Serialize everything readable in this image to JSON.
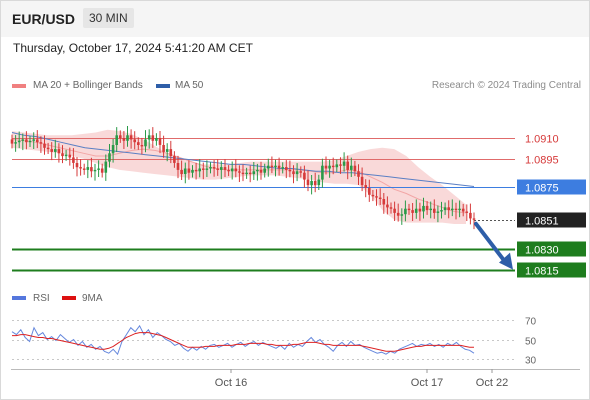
{
  "header": {
    "symbol": "EUR/USD",
    "timeframe": "30 MIN",
    "timestamp": "Thursday, October 17, 2024 5:41:20 AM CET"
  },
  "legend": {
    "ma20_label": "MA 20 + Bollinger Bands",
    "ma50_label": "MA 50",
    "credit": "Research © 2024 Trading Central",
    "rsi_label": "RSI",
    "ma9_label": "9MA"
  },
  "colors": {
    "up": "#2a9a48",
    "down": "#d63a3a",
    "bollinger_fill": "#f7cccc",
    "ma50": "#5a7fc4",
    "resistance": "#e06b6b",
    "pivot": "#3d7de0",
    "support": "#1e7d1e",
    "forecast_arrow": "#2e5ea8",
    "rsi": "#6688dd",
    "rsi_ma": "#dd2222"
  },
  "chart_data": [
    {
      "type": "candlestick",
      "title": "EUR/USD 30 MIN",
      "ylim": [
        1.0809,
        1.0936
      ],
      "x_ticks": [
        "Oct 16",
        "Oct 17",
        "Oct 22"
      ],
      "levels": [
        {
          "value": 1.091,
          "label": "1.0910",
          "kind": "resistance"
        },
        {
          "value": 1.0895,
          "label": "1.0895",
          "kind": "resistance"
        },
        {
          "value": 1.0875,
          "label": "1.0875",
          "kind": "pivot"
        },
        {
          "value": 1.0851,
          "label": "1.0851",
          "kind": "last"
        },
        {
          "value": 1.083,
          "label": "1.0830",
          "kind": "support"
        },
        {
          "value": 1.0815,
          "label": "1.0815",
          "kind": "support"
        }
      ],
      "close_path": [
        1.0906,
        1.0907,
        1.0908,
        1.0909,
        1.0907,
        1.0908,
        1.0909,
        1.0907,
        1.0906,
        1.0903,
        1.0902,
        1.09,
        1.0902,
        1.0899,
        1.0897,
        1.0898,
        1.0896,
        1.0892,
        1.0889,
        1.0888,
        1.0887,
        1.0889,
        1.0886,
        1.0887,
        1.0888,
        1.0885,
        1.0893,
        1.0899,
        1.0905,
        1.0912,
        1.091,
        1.0908,
        1.0912,
        1.0909,
        1.0907,
        1.0905,
        1.0904,
        1.0909,
        1.0912,
        1.0908,
        1.091,
        1.0905,
        1.09,
        1.0902,
        1.0897,
        1.0892,
        1.0887,
        1.0884,
        1.0888,
        1.0885,
        1.0887,
        1.0886,
        1.0888,
        1.0887,
        1.0888,
        1.0889,
        1.0888,
        1.0887,
        1.0889,
        1.0887,
        1.0886,
        1.0888,
        1.0886,
        1.0885,
        1.0884,
        1.0885,
        1.0884,
        1.0886,
        1.0887,
        1.0885,
        1.0888,
        1.089,
        1.0889,
        1.089,
        1.0888,
        1.0889,
        1.0887,
        1.0886,
        1.0884,
        1.0886,
        1.0885,
        1.088,
        1.0876,
        1.0879,
        1.0876,
        1.088,
        1.089,
        1.0888,
        1.089,
        1.0889,
        1.0891,
        1.089,
        1.0893,
        1.0887,
        1.089,
        1.0886,
        1.0882,
        1.0876,
        1.0874,
        1.0869,
        1.0868,
        1.0867,
        1.0866,
        1.0862,
        1.086,
        1.0859,
        1.0856,
        1.0854,
        1.0855,
        1.0859,
        1.0858,
        1.0856,
        1.0859,
        1.0857,
        1.0861,
        1.0858,
        1.0859,
        1.0856,
        1.0857,
        1.0858,
        1.086,
        1.0858,
        1.0859,
        1.0858,
        1.0859,
        1.0857,
        1.0856,
        1.0852,
        1.0851
      ],
      "ma20_path": [
        1.0909,
        1.0908,
        1.0907,
        1.0905,
        1.0903,
        1.0901,
        1.0899,
        1.0897,
        1.0897,
        1.0899,
        1.0901,
        1.0902,
        1.0901,
        1.0899,
        1.0896,
        1.0893,
        1.089,
        1.0888,
        1.0887,
        1.0887,
        1.0887,
        1.0887,
        1.0887,
        1.0887,
        1.0887,
        1.0886,
        1.0885,
        1.0885,
        1.0887,
        1.0886,
        1.0882,
        1.0878,
        1.0873,
        1.087,
        1.0866,
        1.0863,
        1.086,
        1.0857,
        1.0856
      ],
      "bb_upper_path": [
        1.0915,
        1.0914,
        1.0913,
        1.0912,
        1.0912,
        1.0912,
        1.0913,
        1.0914,
        1.0916,
        1.0915,
        1.0913,
        1.0909,
        1.0904,
        1.0899,
        1.0895,
        1.0893,
        1.0891,
        1.0891,
        1.0891,
        1.0892,
        1.0893,
        1.0893,
        1.0893,
        1.0893,
        1.0893,
        1.0893,
        1.0893,
        1.0894,
        1.0897,
        1.09,
        1.0902,
        1.0903,
        1.0902,
        1.0897,
        1.0889,
        1.0882,
        1.0876,
        1.0869,
        1.0862
      ],
      "bb_lower_path": [
        1.0903,
        1.0902,
        1.0901,
        1.09,
        1.0899,
        1.0897,
        1.0895,
        1.0892,
        1.0889,
        1.0887,
        1.0886,
        1.0885,
        1.0884,
        1.0883,
        1.0882,
        1.0881,
        1.088,
        1.088,
        1.0881,
        1.0882,
        1.0883,
        1.0883,
        1.0883,
        1.0882,
        1.0881,
        1.088,
        1.0878,
        1.0877,
        1.0877,
        1.0876,
        1.0869,
        1.0858,
        1.0851,
        1.0849,
        1.0849,
        1.0849,
        1.0849,
        1.0848,
        1.0848
      ],
      "ma50_path": [
        1.0914,
        1.0912,
        1.0911,
        1.0909,
        1.0907,
        1.0905,
        1.0903,
        1.0902,
        1.0901,
        1.09,
        1.0899,
        1.0898,
        1.0897,
        1.0896,
        1.0895,
        1.0894,
        1.0893,
        1.0892,
        1.0891,
        1.0891,
        1.089,
        1.0889,
        1.0888,
        1.0888,
        1.0887,
        1.0886,
        1.0886,
        1.0885,
        1.0885,
        1.0884,
        1.0883,
        1.0882,
        1.0881,
        1.088,
        1.0879,
        1.0878,
        1.0877,
        1.0876,
        1.0875
      ],
      "forecast": {
        "from": 1.0851,
        "to": 1.0815
      }
    },
    {
      "type": "line",
      "title": "RSI",
      "ylim": [
        25,
        75
      ],
      "y_ticks": [
        70,
        50,
        30
      ],
      "series": [
        {
          "name": "RSI",
          "values": [
            58,
            55,
            60,
            52,
            48,
            62,
            54,
            57,
            50,
            53,
            49,
            55,
            51,
            47,
            50,
            44,
            48,
            42,
            45,
            40,
            43,
            38,
            36,
            40,
            35,
            48,
            55,
            62,
            58,
            64,
            55,
            60,
            52,
            57,
            54,
            50,
            48,
            44,
            46,
            41,
            38,
            42,
            39,
            43,
            40,
            44,
            45,
            42,
            44,
            46,
            42,
            45,
            47,
            43,
            46,
            48,
            44,
            47,
            45,
            43,
            41,
            44,
            40,
            46,
            42,
            45,
            43,
            48,
            52,
            47,
            50,
            45,
            42,
            38,
            44,
            47,
            43,
            48,
            44,
            45,
            42,
            40,
            38,
            36,
            37,
            35,
            38,
            36,
            40,
            42,
            44,
            46,
            43,
            45,
            44,
            46,
            43,
            45,
            42,
            46,
            44,
            47,
            43,
            40,
            39,
            36
          ]
        },
        {
          "name": "9MA",
          "values": [
            54,
            54,
            55,
            55,
            54,
            53,
            52,
            52,
            51,
            51,
            50,
            49,
            48,
            47,
            46,
            45,
            44,
            43,
            42,
            41,
            40,
            40,
            41,
            43,
            46,
            49,
            52,
            54,
            56,
            57,
            57,
            57,
            56,
            55,
            54,
            52,
            50,
            48,
            46,
            44,
            42,
            42,
            42,
            42,
            43,
            43,
            43,
            44,
            44,
            44,
            44,
            45,
            45,
            45,
            46,
            46,
            46,
            46,
            45,
            45,
            44,
            44,
            44,
            44,
            45,
            45,
            46,
            47,
            47,
            47,
            46,
            45,
            45,
            44,
            44,
            44,
            44,
            44,
            44,
            44,
            43,
            42,
            41,
            40,
            39,
            38,
            38,
            38,
            39,
            40,
            41,
            42,
            43,
            43,
            44,
            44,
            44,
            44,
            44,
            44,
            44,
            44,
            44,
            43,
            42,
            42
          ]
        }
      ]
    }
  ]
}
